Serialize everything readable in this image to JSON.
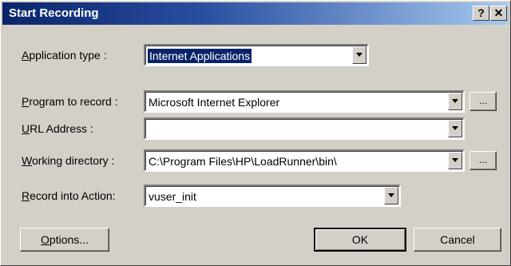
{
  "window": {
    "title": "Start Recording",
    "help_button": "?",
    "close_button": "✕"
  },
  "form": {
    "app_type": {
      "label_prefix": "",
      "label_u": "A",
      "label_rest": "pplication type :",
      "value": "Internet Applications"
    },
    "program": {
      "label_u": "P",
      "label_rest": "rogram to record :",
      "value": "Microsoft Internet Explorer",
      "browse": "..."
    },
    "url": {
      "label_u": "U",
      "label_rest": "RL Address :",
      "value": ""
    },
    "workdir": {
      "label_u": "W",
      "label_rest": "orking directory :",
      "value": "C:\\Program Files\\HP\\LoadRunner\\bin\\",
      "browse": "..."
    },
    "action": {
      "label_u": "R",
      "label_rest": "ecord into Action:",
      "value": "vuser_init"
    }
  },
  "buttons": {
    "options_u": "O",
    "options_rest": "ptions...",
    "ok": "OK",
    "cancel": "Cancel"
  }
}
